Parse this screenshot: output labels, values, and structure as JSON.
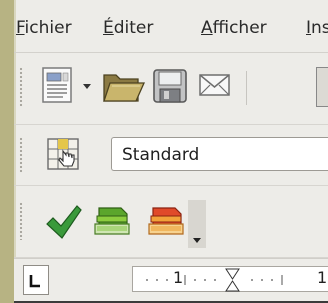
{
  "menubar": {
    "items": [
      {
        "accel": "F",
        "rest": "ichier"
      },
      {
        "accel": "É",
        "rest": "diter"
      },
      {
        "accel": "A",
        "rest": "fficher"
      },
      {
        "accel": "I",
        "rest": "ns"
      }
    ]
  },
  "formatting_toolbar": {
    "style_value": "Standard"
  },
  "ruler": {
    "label_1": "1",
    "label_2": "1"
  },
  "icons": [
    "document-icon",
    "dropdown-arrow-icon",
    "open-folder-icon",
    "save-disk-icon",
    "email-icon",
    "checkmark-icon",
    "green-book-icon",
    "red-book-icon",
    "grid-hand-icon",
    "tab-stop-icon",
    "indent-marker-icon"
  ]
}
